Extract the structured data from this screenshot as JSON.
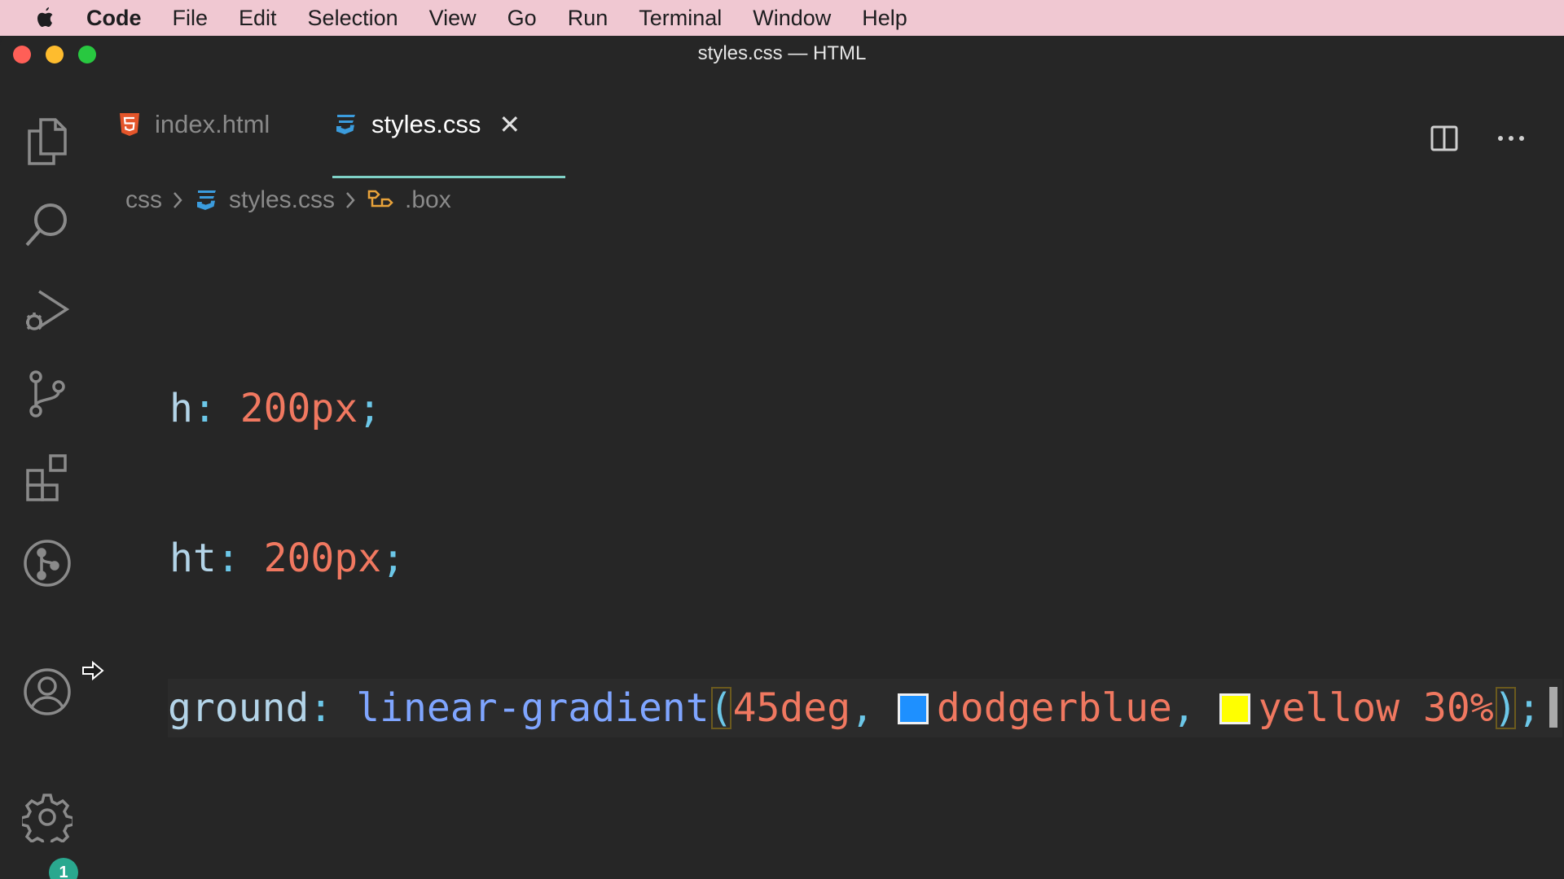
{
  "menubar": {
    "app_name": "Code",
    "items": [
      "File",
      "Edit",
      "Selection",
      "View",
      "Go",
      "Run",
      "Terminal",
      "Window",
      "Help"
    ]
  },
  "window": {
    "title": "styles.css — HTML"
  },
  "activity_bar": {
    "icons": [
      "explorer-icon",
      "search-icon",
      "run-debug-icon",
      "source-control-icon",
      "extensions-icon",
      "git-graph-icon",
      "account-icon",
      "settings-icon"
    ],
    "settings_badge": "1"
  },
  "tabs": [
    {
      "label": "index.html",
      "icon": "html5-icon",
      "active": false
    },
    {
      "label": "styles.css",
      "icon": "css3-icon",
      "active": true
    }
  ],
  "breadcrumb": {
    "folder": "css",
    "file": "styles.css",
    "symbol": ".box"
  },
  "code": {
    "line1": {
      "prop": "h",
      "colon": ":",
      "value": "200px",
      "semi": ";"
    },
    "line2": {
      "prop": "ht",
      "colon": ":",
      "value": "200px",
      "semi": ";"
    },
    "line3": {
      "prop": "ground",
      "colon": ":",
      "fn": "linear-gradient",
      "open": "(",
      "angle": "45deg",
      "comma1": ",",
      "color1": "dodgerblue",
      "comma2": ",",
      "color2": "yellow",
      "stop": "30%",
      "close": ")",
      "semi": ";"
    },
    "swatch_colors": {
      "dodgerblue": "#1e90ff",
      "yellow": "#ffff00"
    }
  },
  "colors": {
    "accent_tab_underline": "#7fd1c7",
    "badge": "#2aa88f"
  }
}
